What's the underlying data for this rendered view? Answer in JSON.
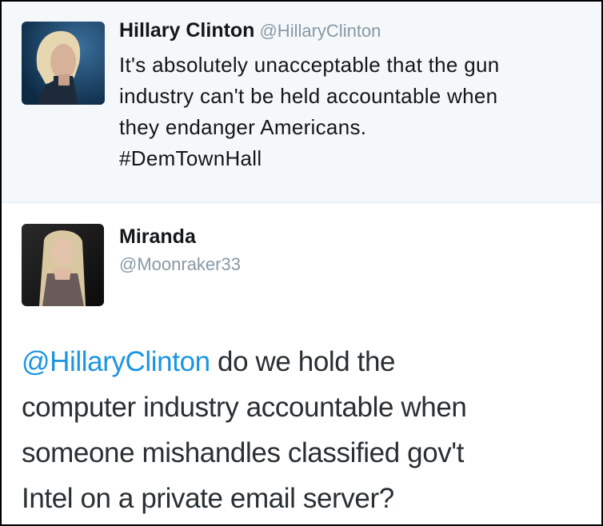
{
  "tweets": [
    {
      "author_name": "Hillary Clinton",
      "author_handle": "@HillaryClinton",
      "avatar": "hillary-clinton-profile-photo",
      "text_lines": [
        "It's absolutely unacceptable that the gun",
        "industry can't be held accountable when",
        "they endanger Americans."
      ],
      "hashtag": "#DemTownHall"
    },
    {
      "author_name": "Miranda",
      "author_handle": "@Moonraker33",
      "avatar": "miranda-profile-photo",
      "mention": "@HillaryClinton",
      "text_first_line_rest": " do we hold the",
      "text_lines": [
        "computer industry accountable when",
        "someone mishandles classified gov't",
        "Intel on a private email server?"
      ]
    }
  ],
  "colors": {
    "parent_background": "#f5f8fa",
    "mention": "#1b95e0",
    "handle": "#8899a6",
    "border": "#000000"
  }
}
